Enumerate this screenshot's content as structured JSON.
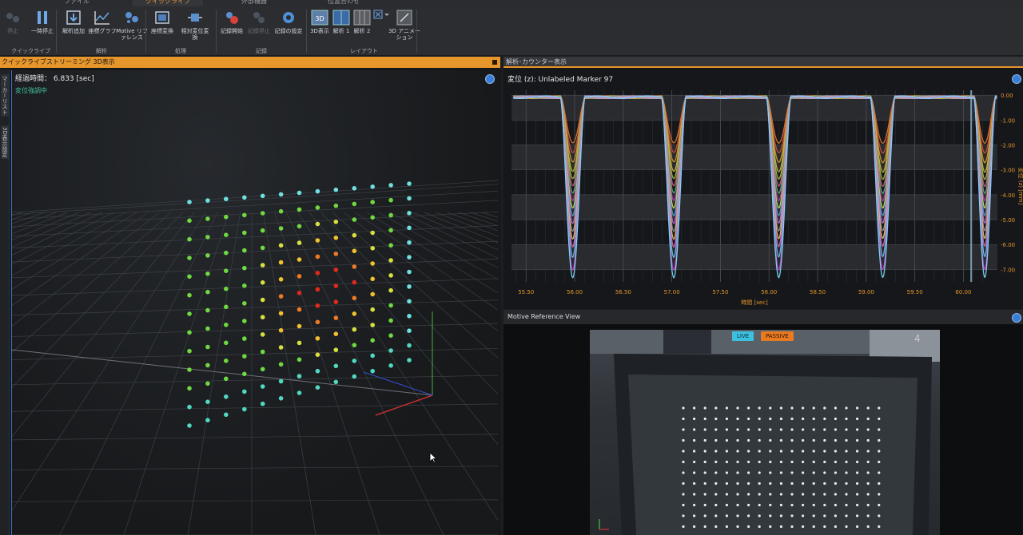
{
  "menu_tabs": [
    "ファイル",
    "クイックライブ",
    "外部機器",
    "位置合わせ"
  ],
  "ribbon": {
    "buttons": [
      {
        "label": "停止",
        "icon": "stop-icon",
        "dim": true
      },
      {
        "label": "一時停止",
        "icon": "pause-icon",
        "dim": false
      },
      {
        "label": "解析追加",
        "icon": "analysis-add-icon",
        "dim": false
      },
      {
        "label": "座標グラフ",
        "icon": "xyz-graph-icon",
        "dim": false
      },
      {
        "label": "Motive リファレンス",
        "icon": "motive-reference-icon",
        "dim": false
      },
      {
        "label": "座標変換",
        "icon": "coordinate-transform-icon",
        "dim": false
      },
      {
        "label": "相対変位変換",
        "icon": "relative-displacement-icon",
        "dim": false
      },
      {
        "label": "記録開始",
        "icon": "record-start-icon",
        "dim": false
      },
      {
        "label": "記録停止",
        "icon": "record-stop-icon",
        "dim": true
      },
      {
        "label": "記録の設定",
        "icon": "record-settings-icon",
        "dim": false
      },
      {
        "label": "3D表示",
        "icon": "3d-view-icon",
        "dim": false
      },
      {
        "label": "解析 1",
        "icon": "layout-analysis-1-icon",
        "dim": false
      },
      {
        "label": "解析 2",
        "icon": "layout-analysis-2-icon",
        "dim": false
      },
      {
        "label": "3D アニメーション",
        "icon": "3d-animation-icon",
        "dim": false
      }
    ],
    "groups": [
      "クイックライブ",
      "解析",
      "処理",
      "記録",
      "レイアウト"
    ]
  },
  "left_panel": {
    "title": "クイックライブストリーミング    3D表示",
    "side_tabs": [
      "マーカーリスト",
      "3D表示設定"
    ],
    "elapsed_label": "経過時間：",
    "elapsed_value": "6.833 [sec]",
    "status": "変位強調中"
  },
  "graph_panel": {
    "title": "解析･カウンター表示",
    "subtitle": "変位 (z):  Unlabeled Marker 97",
    "chart_data": {
      "type": "line",
      "xlabel": "時間 [sec]",
      "ylabel": "変位 (z) [mm]",
      "xlim": [
        55.35,
        60.35
      ],
      "ylim": [
        -7.5,
        0.2
      ],
      "x_ticks": [
        55.5,
        56.0,
        56.5,
        57.0,
        57.5,
        58.0,
        58.5,
        59.0,
        59.5,
        60.0
      ],
      "x_tick_labels": [
        "55.50",
        "56.00",
        "56.50",
        "57.00",
        "57.50",
        "58.00",
        "58.50",
        "59.00",
        "59.50",
        "60.00"
      ],
      "y_ticks": [
        0,
        -1,
        -2,
        -3,
        -4,
        -5,
        -6,
        -7
      ],
      "y_tick_labels": [
        "0.00",
        "-1.00",
        "-2.00",
        "-3.00",
        "-4.00",
        "-5.00",
        "-6.00",
        "-7.00"
      ],
      "dips": [
        {
          "center": 55.98,
          "width": 0.25
        },
        {
          "center": 57.02,
          "width": 0.25
        },
        {
          "center": 58.1,
          "width": 0.25
        },
        {
          "center": 59.17,
          "width": 0.25
        },
        {
          "center": 60.22,
          "width": 0.22
        }
      ],
      "series_depths": [
        -1.8,
        -2.2,
        -2.6,
        -3.0,
        -3.3,
        -3.6,
        -3.9,
        -4.2,
        -4.5,
        -4.8,
        -5.1,
        -5.4,
        -5.7,
        -6.0,
        -6.4,
        -6.9,
        -7.2
      ],
      "series_colors": [
        "#e07a3a",
        "#d85040",
        "#e0a030",
        "#cfc040",
        "#9ad040",
        "#e06080",
        "#50c070",
        "#c040c0",
        "#e0e050",
        "#40b0d0",
        "#d070e0",
        "#a0a0a0",
        "#e0d060",
        "#f060c0",
        "#60d0f0",
        "#d040d0",
        "#80e0ff"
      ],
      "grid": true
    }
  },
  "ref_panel": {
    "title": "Motive Reference View",
    "live": "LIVE",
    "passive": "PASSIVE",
    "camera_number": "4"
  }
}
